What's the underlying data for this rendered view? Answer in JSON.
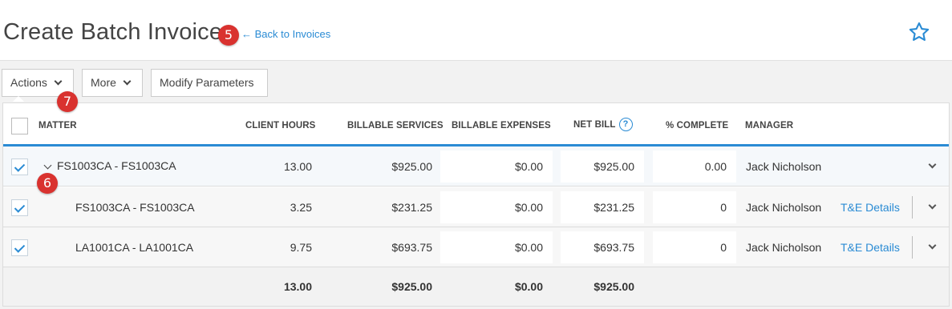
{
  "header": {
    "title": "Create Batch Invoice",
    "back_link": "← Back to Invoices",
    "star_icon": "star-outline-icon",
    "accent": "#2a8bd4"
  },
  "callouts": {
    "five": "5",
    "six": "6",
    "seven": "7",
    "color": "#d9322f"
  },
  "toolbar": {
    "actions": "Actions",
    "more": "More",
    "modify": "Modify Parameters"
  },
  "table": {
    "columns": {
      "matter": "MATTER",
      "client_hours": "CLIENT HOURS",
      "billable_services": "BILLABLE SERVICES",
      "billable_expenses": "BILLABLE EXPENSES",
      "net_bill": "NET BILL",
      "net_bill_help": "?",
      "pct_complete": "% COMPLETE",
      "manager": "MANAGER"
    },
    "rows": [
      {
        "matter": "FS1003CA - FS1003CA",
        "client_hours": "13.00",
        "billable_services": "$925.00",
        "billable_expenses": "$0.00",
        "net_bill": "$925.00",
        "pct_complete": "0.00",
        "manager": "Jack Nicholson",
        "details": ""
      },
      {
        "matter": "FS1003CA - FS1003CA",
        "client_hours": "3.25",
        "billable_services": "$231.25",
        "billable_expenses": "$0.00",
        "net_bill": "$231.25",
        "pct_complete": "0",
        "manager": "Jack Nicholson",
        "details": "T&E Details"
      },
      {
        "matter": "LA1001CA - LA1001CA",
        "client_hours": "9.75",
        "billable_services": "$693.75",
        "billable_expenses": "$0.00",
        "net_bill": "$693.75",
        "pct_complete": "0",
        "manager": "Jack Nicholson",
        "details": "T&E Details"
      }
    ],
    "totals": {
      "client_hours": "13.00",
      "billable_services": "$925.00",
      "billable_expenses": "$0.00",
      "net_bill": "$925.00"
    }
  }
}
